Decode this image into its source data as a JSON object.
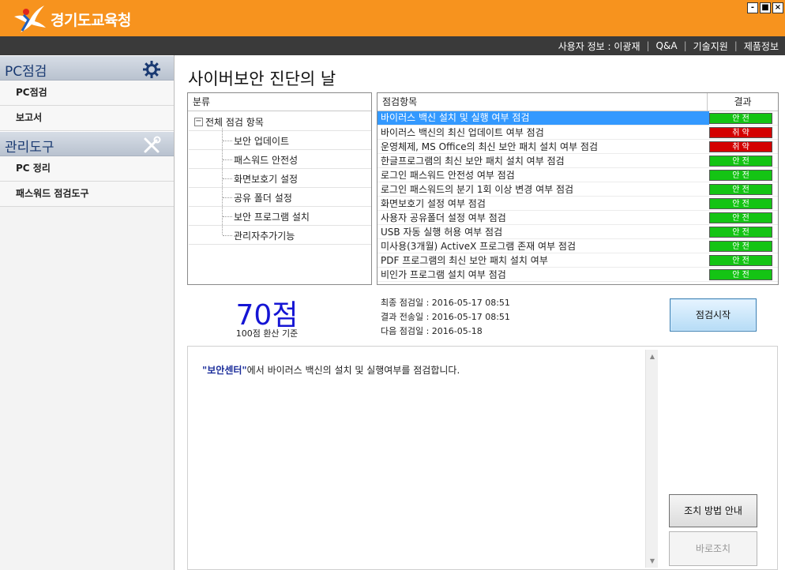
{
  "header": {
    "logo_text": "경기도교육청",
    "window_buttons": [
      "-",
      "■",
      "×"
    ]
  },
  "topbar": {
    "user_info": "사용자 정보 : 이광재",
    "qa": "Q&A",
    "tech_support": "기술지원",
    "product_info": "제품정보"
  },
  "sidebar": {
    "sections": [
      {
        "title": "PC점검",
        "icon": "gear-icon",
        "items": [
          "PC점검",
          "보고서"
        ]
      },
      {
        "title": "관리도구",
        "icon": "tools-icon",
        "items": [
          "PC 정리",
          "패스워드 점검도구"
        ]
      }
    ]
  },
  "main": {
    "title": "사이버보안 진단의 날",
    "tree": {
      "header": "분류",
      "root": "전체 점검 항목",
      "toggle": "−",
      "children": [
        "보안 업데이트",
        "패스워드 안전성",
        "화면보호기 설정",
        "공유 폴더 설정",
        "보안 프로그램 설치",
        "관리자추가기능"
      ]
    },
    "items": {
      "header_item": "점검항목",
      "header_result": "결과",
      "rows": [
        {
          "label": "바이러스 백신 설치 및 실행 여부 점검",
          "result": "안 전",
          "status": "safe"
        },
        {
          "label": "바이러스 백신의 최신 업데이트 여부 점검",
          "result": "취 약",
          "status": "weak"
        },
        {
          "label": "운영체제, MS Office의 최신 보안 패치 설치 여부 점검",
          "result": "취 약",
          "status": "weak"
        },
        {
          "label": "한글프로그램의 최신 보안 패치 설치 여부 점검",
          "result": "안 전",
          "status": "safe"
        },
        {
          "label": "로그인 패스워드 안전성 여부 점검",
          "result": "안 전",
          "status": "safe"
        },
        {
          "label": "로그인 패스워드의 분기 1회 이상 변경 여부 점검",
          "result": "안 전",
          "status": "safe"
        },
        {
          "label": "화면보호기 설정 여부 점검",
          "result": "안 전",
          "status": "safe"
        },
        {
          "label": "사용자 공유폴더 설정 여부 점검",
          "result": "안 전",
          "status": "safe"
        },
        {
          "label": "USB 자동 실행 허용 여부 점검",
          "result": "안 전",
          "status": "safe"
        },
        {
          "label": "미사용(3개월) ActiveX 프로그램 존재 여부 점검",
          "result": "안 전",
          "status": "safe"
        },
        {
          "label": "PDF 프로그램의 최신 보안 패치 설치 여부",
          "result": "안 전",
          "status": "safe"
        },
        {
          "label": "비인가 프로그램 설치 여부 점검",
          "result": "안 전",
          "status": "safe"
        }
      ]
    },
    "score": {
      "value": "70점",
      "subtitle": "100점 환산 기준"
    },
    "dates": {
      "last_check": "최종 점검일 : 2016-05-17 08:51",
      "result_sent": "결과 전송일 : 2016-05-17 08:51",
      "next_check": "다음 점검일 : 2016-05-18"
    },
    "buttons": {
      "start": "점검시작",
      "guide": "조치 방법 안내",
      "fix_now": "바로조치"
    },
    "description": {
      "highlight": "\"보안센터\"",
      "text": "에서 바이러스 백신의 설치 및 실행여부를 점검합니다."
    }
  },
  "colors": {
    "header": "#f7931e",
    "topbar": "#3a3a3a",
    "safe": "#14c414",
    "weak": "#d40000",
    "score": "#1515d4",
    "selected": "#3399ff"
  }
}
